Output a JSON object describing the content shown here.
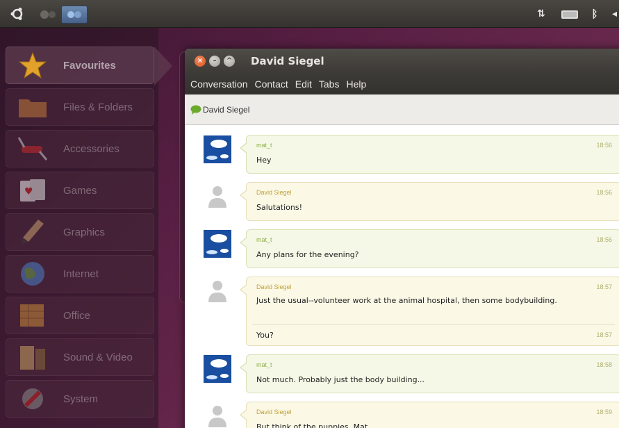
{
  "panel": {
    "indicators": [
      "network",
      "battery",
      "bluetooth"
    ]
  },
  "launcher": {
    "categories": [
      {
        "label": "Favourites",
        "icon": "star-icon",
        "active": true
      },
      {
        "label": "Files & Folders",
        "icon": "folder-icon"
      },
      {
        "label": "Accessories",
        "icon": "swiss-knife-icon"
      },
      {
        "label": "Games",
        "icon": "cards-icon"
      },
      {
        "label": "Graphics",
        "icon": "paintbrush-icon"
      },
      {
        "label": "Internet",
        "icon": "globe-icon"
      },
      {
        "label": "Office",
        "icon": "office-icon"
      },
      {
        "label": "Sound & Video",
        "icon": "media-icon"
      },
      {
        "label": "System",
        "icon": "wrench-icon"
      }
    ]
  },
  "window": {
    "title": "David Siegel",
    "menu": [
      "Conversation",
      "Contact",
      "Edit",
      "Tabs",
      "Help"
    ],
    "tab_label": "David Siegel"
  },
  "messages": [
    {
      "sender": "mat_t",
      "time": "18:56",
      "text": "Hey",
      "self": true
    },
    {
      "sender": "David Siegel",
      "time": "18:56",
      "text": "Salutations!",
      "self": false
    },
    {
      "sender": "mat_t",
      "time": "18:56",
      "text": "Any plans for the evening?",
      "self": true
    },
    {
      "sender": "David Siegel",
      "time": "18:57",
      "text": "Just the usual--volunteer work at the animal hospital, then some bodybuilding.",
      "self": false,
      "extra_text": "You?",
      "extra_time": "18:57"
    },
    {
      "sender": "mat_t",
      "time": "18:58",
      "text": "Not much. Probably just the body building...",
      "self": true
    },
    {
      "sender": "David Siegel",
      "time": "18:59",
      "text": "But think of the puppies, Mat.",
      "self": false
    }
  ],
  "colors": {
    "accent_close": "#e0622c",
    "bubble_self": "#f5f8e6",
    "bubble_other": "#fbf8e6",
    "sender_self": "#8fb04a",
    "sender_other": "#c0a23a"
  }
}
